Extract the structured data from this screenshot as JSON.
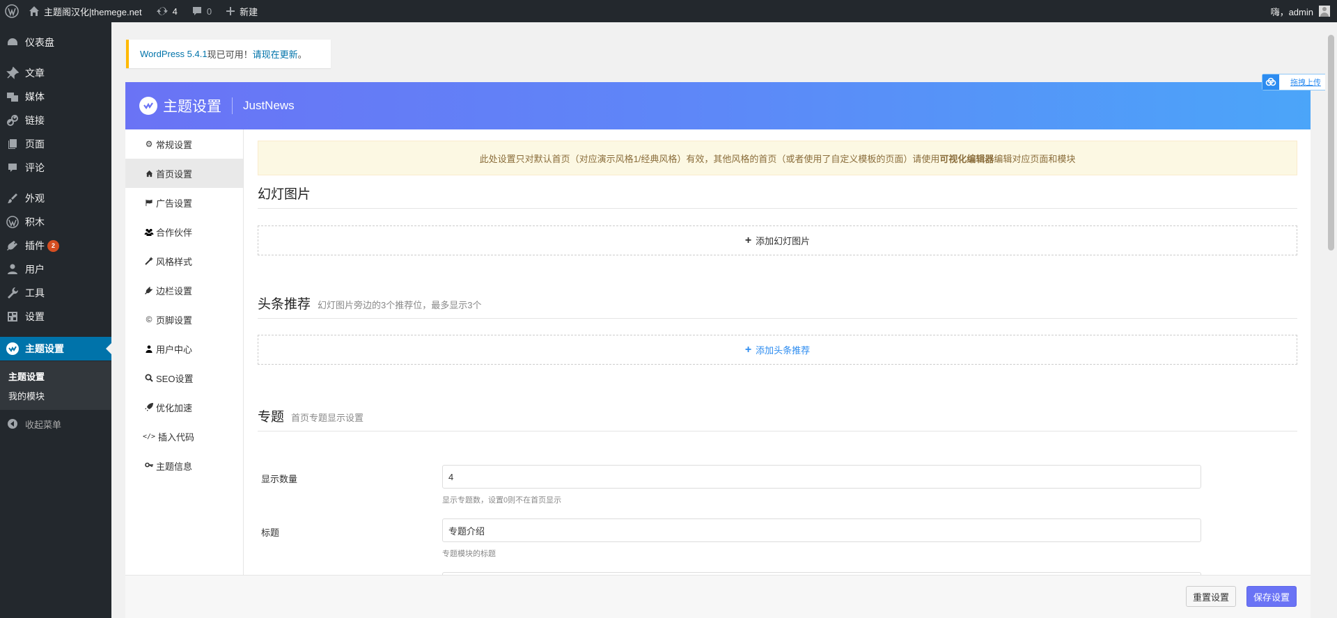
{
  "adminbar": {
    "site_name": "主题阁汉化|themege.net",
    "updates_count": "4",
    "comments_count": "0",
    "new_label": "新建",
    "greeting": "嗨，admin"
  },
  "menu": {
    "items": [
      {
        "label": "仪表盘",
        "icon": "dashboard-icon"
      },
      {
        "label": "文章",
        "icon": "pin-icon"
      },
      {
        "label": "媒体",
        "icon": "media-icon"
      },
      {
        "label": "链接",
        "icon": "link-icon"
      },
      {
        "label": "页面",
        "icon": "page-icon"
      },
      {
        "label": "评论",
        "icon": "comment-icon"
      },
      {
        "label": "外观",
        "icon": "brush-icon"
      },
      {
        "label": "积木",
        "icon": "wordpress-icon"
      },
      {
        "label": "插件",
        "icon": "plugin-icon",
        "badge": "2"
      },
      {
        "label": "用户",
        "icon": "user-icon"
      },
      {
        "label": "工具",
        "icon": "wrench-icon"
      },
      {
        "label": "设置",
        "icon": "settings-icon"
      },
      {
        "label": "主题设置",
        "icon": "theme-logo-icon"
      }
    ],
    "submenu": [
      "主题设置",
      "我的模块"
    ],
    "collapse_label": "收起菜单"
  },
  "update_notice": {
    "version_link": "WordPress 5.4.1",
    "text": "现已可用！",
    "update_link": "请现在更新",
    "end": "。"
  },
  "floating_upload": {
    "label": "拖拽上传"
  },
  "panel": {
    "title": "主题设置",
    "theme_name": "JustNews",
    "nav": [
      {
        "label": "常规设置",
        "icon": "gear-icon"
      },
      {
        "label": "首页设置",
        "icon": "home-icon"
      },
      {
        "label": "广告设置",
        "icon": "flag-icon"
      },
      {
        "label": "合作伙伴",
        "icon": "users-icon"
      },
      {
        "label": "风格样式",
        "icon": "magic-wand-icon"
      },
      {
        "label": "边栏设置",
        "icon": "plug-icon"
      },
      {
        "label": "页脚设置",
        "icon": "copyright-icon"
      },
      {
        "label": "用户中心",
        "icon": "user-icon"
      },
      {
        "label": "SEO设置",
        "icon": "search-icon"
      },
      {
        "label": "优化加速",
        "icon": "rocket-icon"
      },
      {
        "label": "插入代码",
        "icon": "code-icon"
      },
      {
        "label": "主题信息",
        "icon": "key-icon"
      }
    ],
    "notice": {
      "before": "此处设置只对默认首页（对应演示风格1/经典风格）有效，其他风格的首页（或者使用了自定义模板的页面）请使用",
      "bold": "可视化编辑器",
      "after": "编辑对应页面和模块"
    },
    "slides": {
      "title": "幻灯图片",
      "add_label": "添加幻灯图片"
    },
    "headline": {
      "title": "头条推荐",
      "desc": "幻灯图片旁边的3个推荐位，最多显示3个",
      "add_label": "添加头条推荐"
    },
    "topic": {
      "title": "专题",
      "desc": "首页专题显示设置",
      "fields": [
        {
          "label": "显示数量",
          "value": "4",
          "help": "显示专题数，设置0则不在首页显示"
        },
        {
          "label": "标题",
          "value": "专题介绍",
          "help": "专题模块的标题"
        }
      ]
    },
    "buttons": {
      "reset": "重置设置",
      "save": "保存设置"
    }
  }
}
